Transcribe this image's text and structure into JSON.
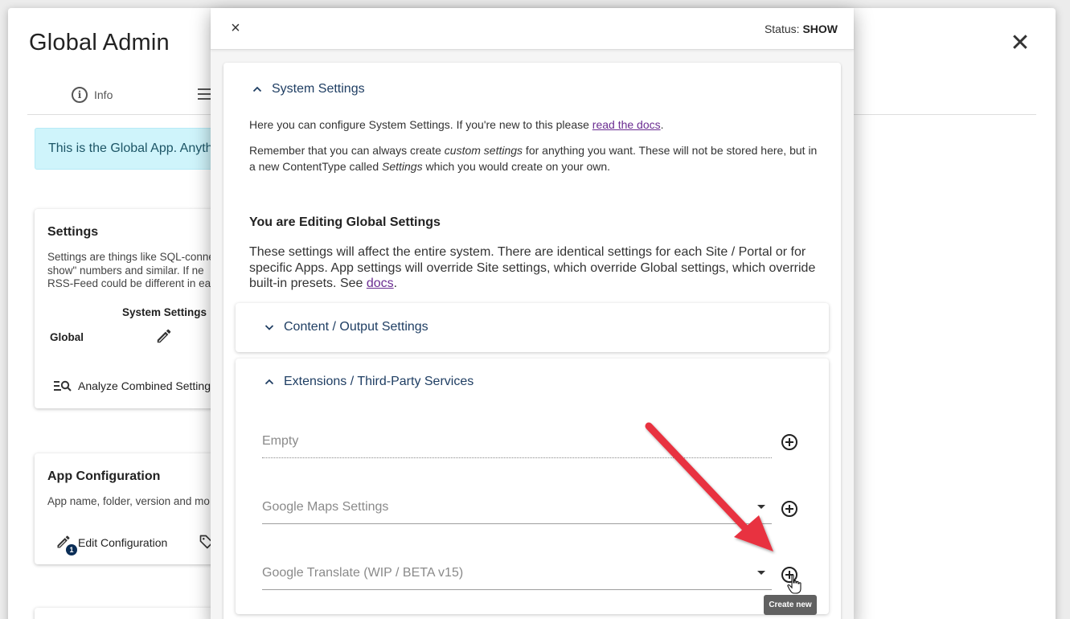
{
  "background": {
    "title": "Global Admin",
    "tabs": [
      {
        "label": "Info"
      }
    ],
    "alert": "This is the Global App. Anything",
    "settings_card": {
      "title": "Settings",
      "text_lines": [
        "Settings are things like SQL-connec",
        "show\" numbers and similar. If ne",
        "RSS-Feed could be different in ea"
      ],
      "column_header": "System Settings",
      "row_label": "Global",
      "analyze_label": "Analyze Combined Settings"
    },
    "app_card": {
      "title": "App Configuration",
      "text": "App name, folder, version and mo",
      "edit_label": "Edit Configuration",
      "badge": "1"
    }
  },
  "dialog": {
    "close_label": "×",
    "status_label": "Status:",
    "status_value": "SHOW",
    "section_title": "System Settings",
    "intro": {
      "line1_before": "Here you can configure System Settings. If you're new to this please ",
      "line1_link": "read the docs",
      "line1_after": ".",
      "line2_part1": "Remember that you can always create ",
      "line2_em1": "custom settings",
      "line2_part2": " for anything you want. These will not be stored here, but in",
      "line3_part1": "a new ContentType called ",
      "line3_em": "Settings",
      "line3_part2": " which you would create on your own."
    },
    "editing_heading": "You are Editing Global Settings",
    "editing_body": {
      "before_link": "These settings will affect the entire system. There are identical settings for each Site / Portal or for specific Apps. App settings will override Site settings, which override Global settings, which override built-in presets. See ",
      "link": "docs",
      "after_link": "."
    },
    "content_output": {
      "title": "Content / Output Settings",
      "expanded": false
    },
    "extensions": {
      "title": "Extensions / Third-Party Services",
      "expanded": true,
      "fields": [
        {
          "label": "Empty",
          "type": "empty"
        },
        {
          "label": "Google Maps Settings",
          "type": "select"
        },
        {
          "label": "Google Translate (WIP / BETA v15)",
          "type": "select"
        }
      ]
    },
    "tooltip": "Create new"
  },
  "colors": {
    "accent_dark": "#1f3e63",
    "link": "#6a2c91",
    "annotation_arrow": "#e8323f",
    "alert_bg": "#cff4fb"
  }
}
